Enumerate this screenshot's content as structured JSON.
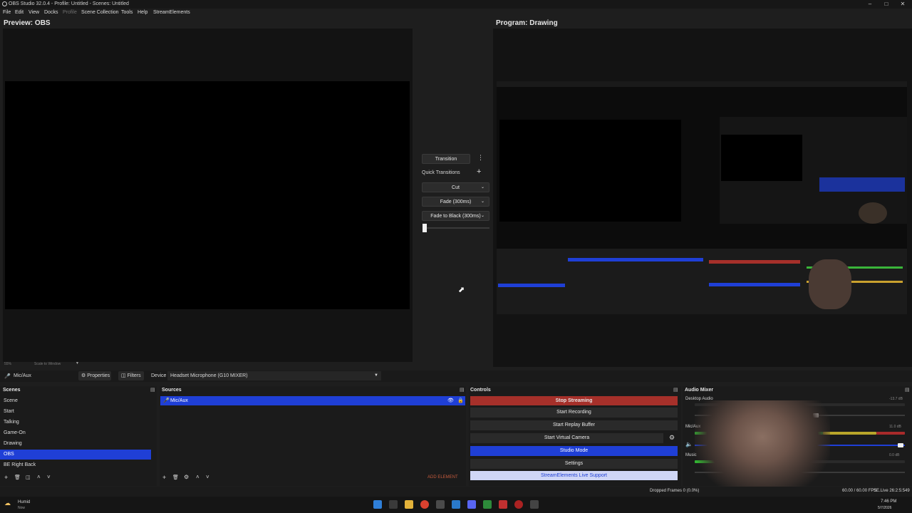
{
  "window": {
    "title": "OBS Studio 32.0.4 - Profile: Untitled - Scenes: Untitled"
  },
  "menu": [
    "File",
    "Edit",
    "View",
    "Docks",
    "Profile",
    "Scene Collection",
    "Tools",
    "Help",
    "StreamElements"
  ],
  "preview": {
    "title": "Preview: OBS",
    "zoom": "55%",
    "scale_mode": "Scale to Window"
  },
  "program": {
    "title": "Program: Drawing"
  },
  "transitions": {
    "transition_label": "Transition",
    "quick_label": "Quick Transitions",
    "items": [
      "Cut",
      "Fade (300ms)",
      "Fade to Black (300ms)"
    ]
  },
  "source_bar": {
    "source_name": "Mic/Aux",
    "properties": "Properties",
    "filters": "Filters",
    "device_label": "Device",
    "device_value": "Headset Microphone (G10 MIXER)"
  },
  "scenes": {
    "header": "Scenes",
    "items": [
      "Scene",
      "Start",
      "Talking",
      "Game-On",
      "Drawing",
      "OBS",
      "BE Right Back"
    ],
    "selected": "OBS"
  },
  "sources": {
    "header": "Sources",
    "items": [
      "Mic/Aux"
    ],
    "add_element": "ADD ELEMENT"
  },
  "controls": {
    "header": "Controls",
    "stop_streaming": "Stop Streaming",
    "start_recording": "Start Recording",
    "start_replay": "Start Replay Buffer",
    "start_virtual": "Start Virtual Camera",
    "studio_mode": "Studio Mode",
    "settings": "Settings",
    "se_support": "StreamElements Live Support"
  },
  "audio_mixer": {
    "header": "Audio Mixer",
    "channels": [
      {
        "name": "Desktop Audio",
        "db": "-13.7 dB"
      },
      {
        "name": "Mic/Aux",
        "db": "11.0 dB"
      },
      {
        "name": "Music",
        "db": "0.0 dB"
      }
    ]
  },
  "status": {
    "dropped": "Dropped Frames 0 (0.0%)",
    "fps": "60.00 / 60.00 FPS",
    "live": "SE.Live 26:2:5:549"
  },
  "taskbar": {
    "weather_temp": "Humid",
    "weather_sub": "Now",
    "time": "7:46 PM",
    "date": "5/7/2026"
  },
  "colors": {
    "accent": "#1f3fd6",
    "stop": "#a6302a",
    "bg": "#1e1e1e"
  }
}
